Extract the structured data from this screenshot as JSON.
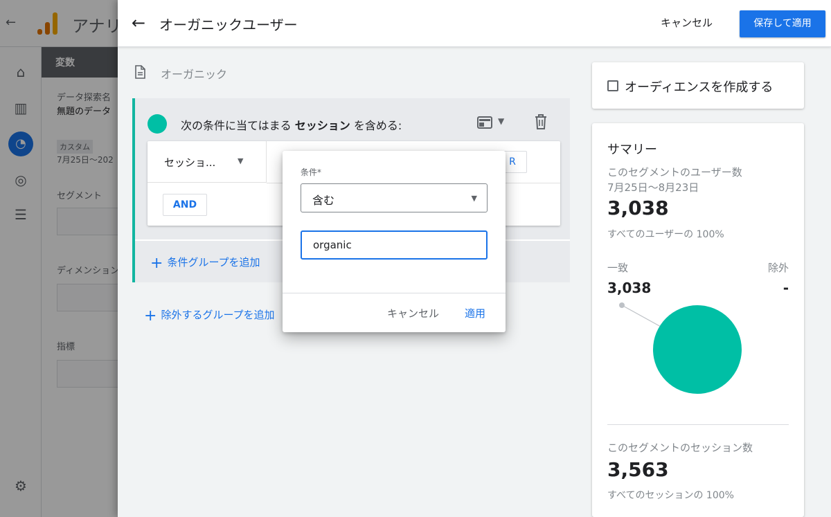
{
  "app": {
    "name": "アナリ",
    "back_icon": "arrow-left-icon"
  },
  "variables_panel": {
    "title": "変数",
    "exploration_name_label": "データ探索名",
    "exploration_name_value": "無題のデータ",
    "date_chip": "カスタム",
    "date_range": "7月25日～202",
    "segments_label": "セグメント",
    "dimensions_label": "ディメンション",
    "metrics_label": "指標"
  },
  "segment_editor": {
    "title": "オーガニックユーザー",
    "cancel_label": "キャンセル",
    "save_apply_label": "保存して適用",
    "segment_name": "オーガニック",
    "condition_prefix": "次の条件に当てはまる",
    "condition_scope": "セッション",
    "condition_suffix": "を含める:",
    "dimension_label": "セッショ...",
    "or_label": "R",
    "and_label": "AND",
    "add_condition_group": "条件グループを追加",
    "add_exclude_group": "除外するグループを追加"
  },
  "audience": {
    "label": "オーディエンスを作成する"
  },
  "summary": {
    "title": "サマリー",
    "users_label": "このセグメントのユーザー数",
    "date_range": "7月25日～8月23日",
    "users_value": "3,038",
    "users_share": "すべてのユーザーの 100%",
    "match_label": "一致",
    "exclude_label": "除外",
    "match_value": "3,038",
    "exclude_value": "-",
    "sessions_label": "このセグメントのセッション数",
    "sessions_value": "3,563",
    "sessions_share": "すべてのセッションの 100%"
  },
  "dialog": {
    "condition_label": "条件*",
    "operator_value": "含む",
    "input_value": "organic",
    "cancel_label": "キャンセル",
    "apply_label": "適用"
  },
  "colors": {
    "accent": "#1a73e8",
    "segment_teal": "#00bfa5"
  }
}
